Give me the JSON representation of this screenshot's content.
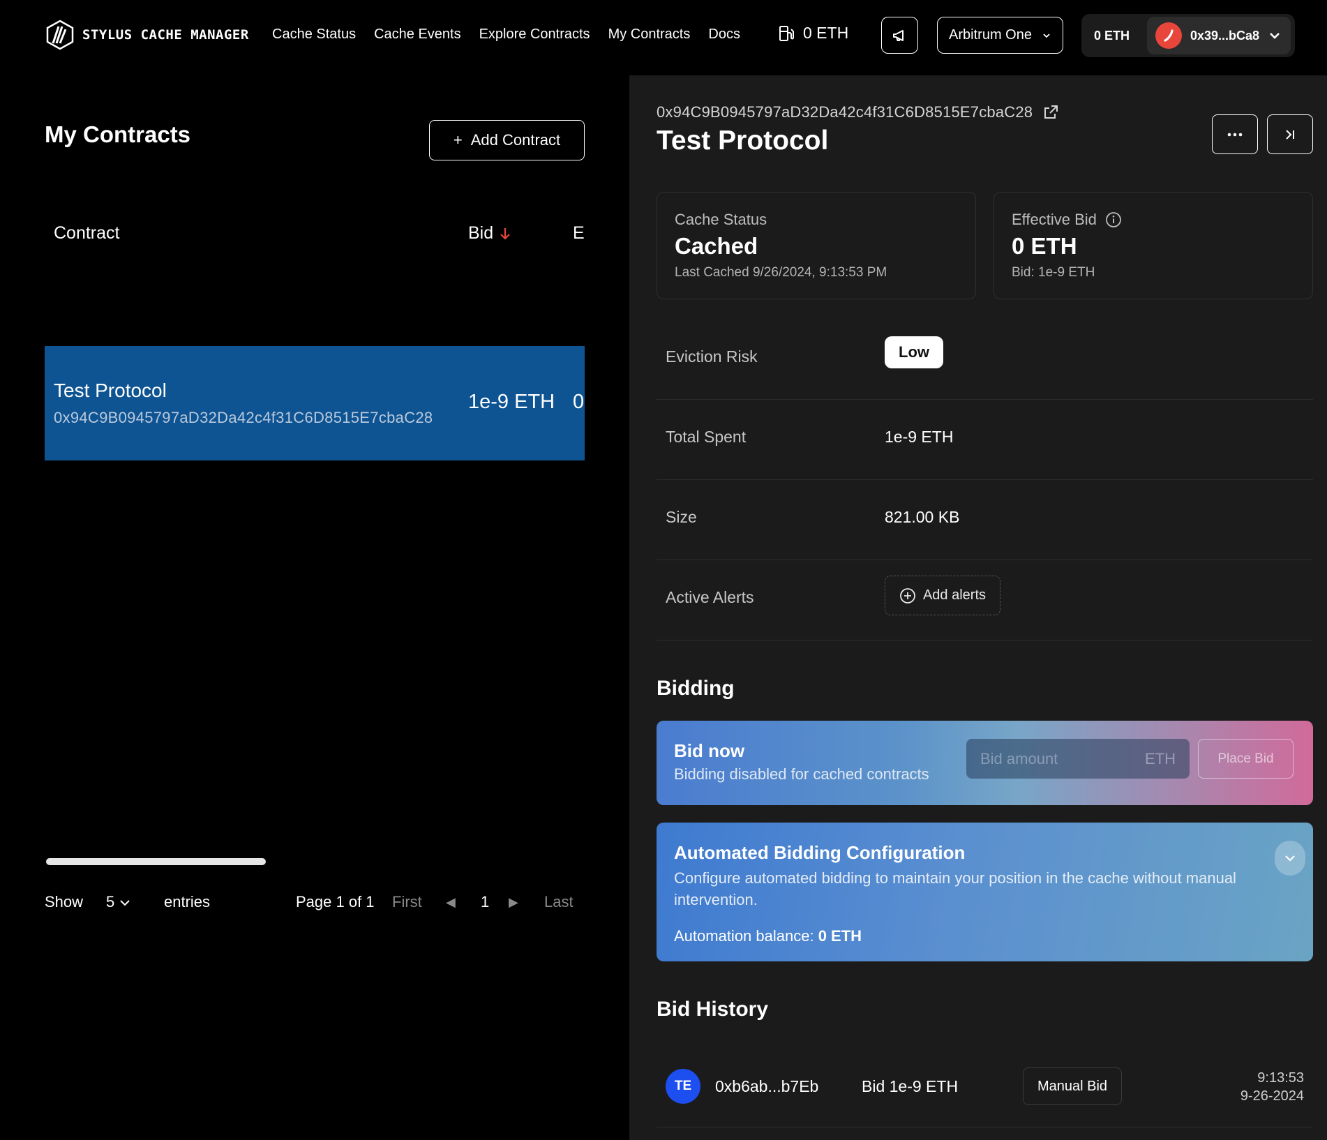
{
  "nav": {
    "brand": "STYLUS CACHE MANAGER",
    "links": [
      "Cache Status",
      "Cache Events",
      "Explore Contracts",
      "My Contracts",
      "Docs"
    ],
    "gas_value": "0 ETH",
    "network": "Arbitrum One",
    "wallet_balance": "0 ETH",
    "wallet_address": "0x39...bCa8"
  },
  "left": {
    "title": "My Contracts",
    "add_button": "Add Contract",
    "add_icon": "+",
    "columns": {
      "contract": "Contract",
      "bid": "Bid",
      "third": "E"
    },
    "rows": [
      {
        "name": "Test Protocol",
        "address": "0x94C9B0945797aD32Da42c4f31C6D8515E7cbaC28",
        "bid": "1e-9 ETH",
        "third": "0"
      }
    ],
    "pager": {
      "show": "Show",
      "entries_count": "5",
      "entries": "entries",
      "page_info": "Page 1 of 1",
      "first": "First",
      "prev": "◀",
      "current": "1",
      "next": "▶",
      "last": "Last"
    }
  },
  "detail": {
    "address": "0x94C9B0945797aD32Da42c4f31C6D8515E7cbaC28",
    "title": "Test Protocol",
    "cache_status": {
      "label": "Cache Status",
      "value": "Cached",
      "sub": "Last Cached 9/26/2024, 9:13:53 PM"
    },
    "effective_bid": {
      "label": "Effective Bid",
      "value": "0 ETH",
      "sub": "Bid: 1e-9 ETH"
    },
    "eviction_risk": {
      "label": "Eviction Risk",
      "value": "Low"
    },
    "total_spent": {
      "label": "Total Spent",
      "value": "1e-9 ETH"
    },
    "size": {
      "label": "Size",
      "value": "821.00 KB"
    },
    "active_alerts": {
      "label": "Active Alerts",
      "button": "Add alerts"
    },
    "bidding_title": "Bidding",
    "bid_now": {
      "title": "Bid now",
      "subtitle": "Bidding disabled for cached contracts",
      "placeholder": "Bid amount",
      "unit": "ETH",
      "button": "Place Bid"
    },
    "automation": {
      "title": "Automated Bidding Configuration",
      "description": "Configure automated bidding to maintain your position in the cache without manual intervention.",
      "balance_label": "Automation balance:",
      "balance_value": "0 ETH"
    },
    "history_title": "Bid History",
    "history": [
      {
        "initials": "TE",
        "address": "0xb6ab...b7Eb",
        "bid": "Bid 1e-9 ETH",
        "type": "Manual Bid",
        "time": "9:13:53",
        "date": "9-26-2024"
      }
    ]
  },
  "colors": {
    "selected_row": "#0e5493",
    "panel": "#1b1b1b",
    "risk_pill": "#ffffff",
    "history_avatar": "#1d4ff0",
    "wallet_avatar": "#e8463a",
    "sort_arrow": "#e8463a"
  }
}
